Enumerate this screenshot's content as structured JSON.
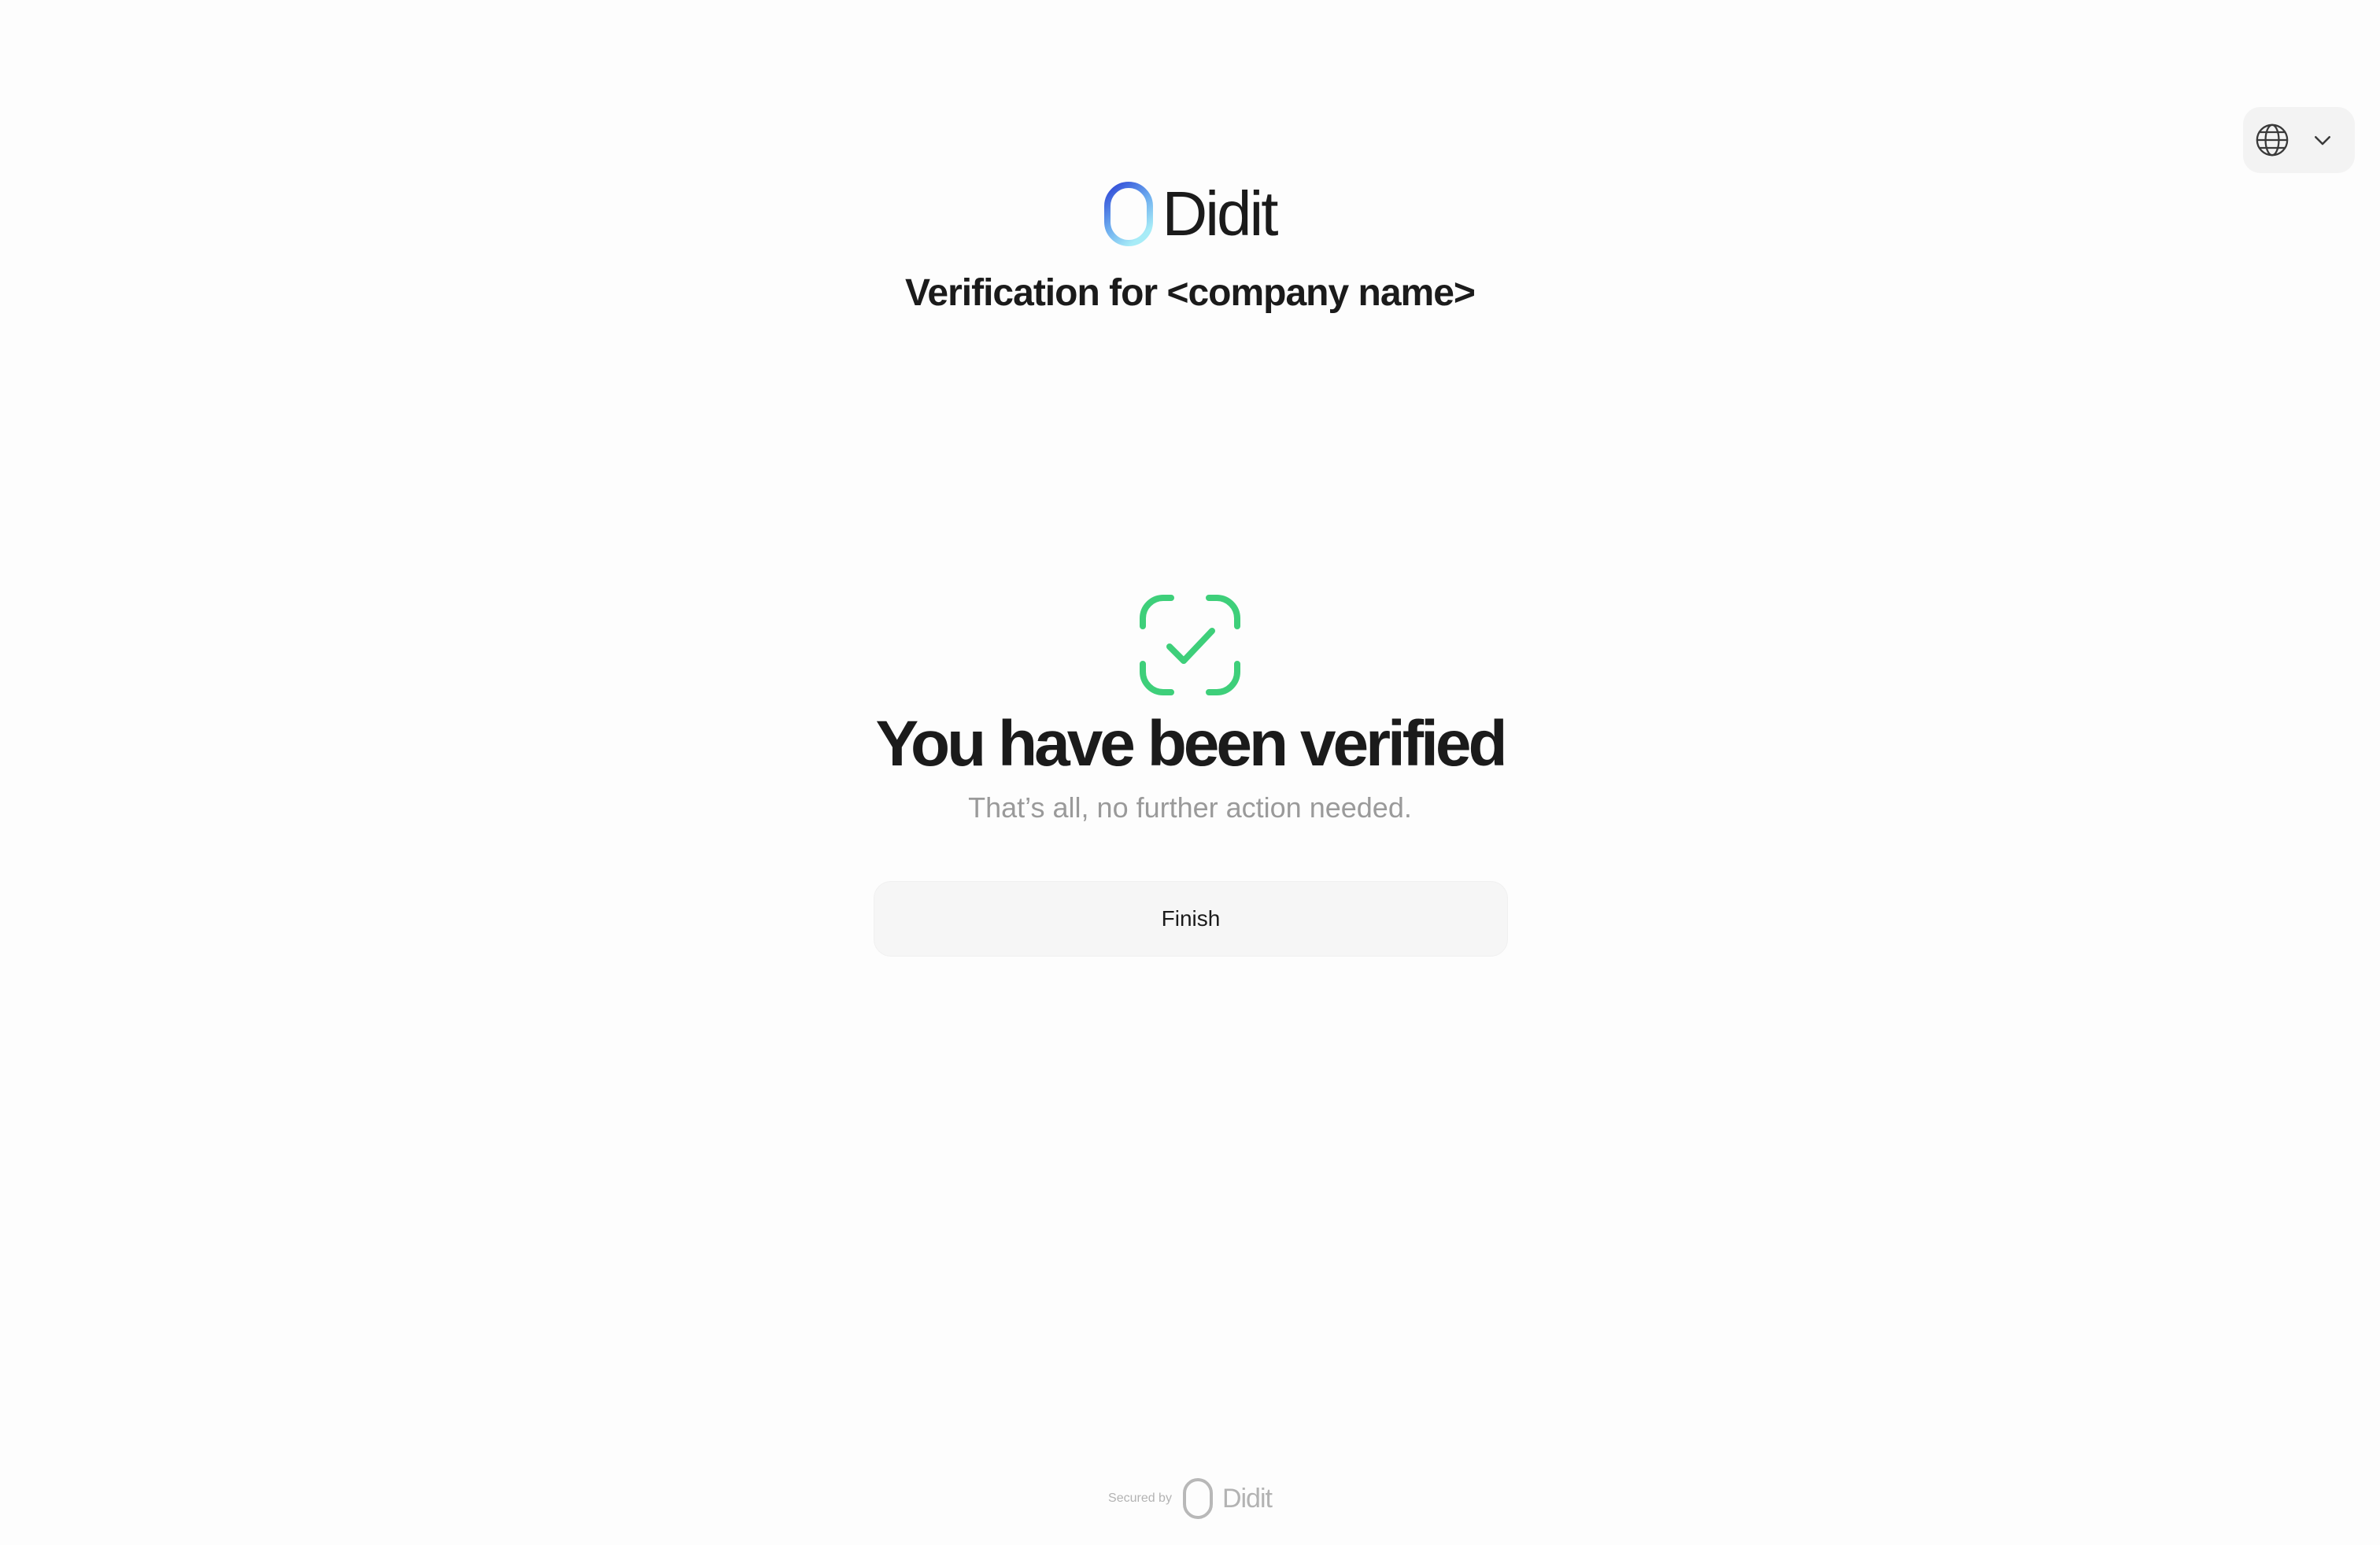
{
  "language_selector": {
    "icon": "globe-icon",
    "chevron": "chevron-down-icon"
  },
  "header": {
    "brand_name": "Didit",
    "subtitle": "Verification for <company name>"
  },
  "result": {
    "icon": "verified-check-icon",
    "headline": "You have been verified",
    "message": "That’s all, no further action needed.",
    "finish_label": "Finish"
  },
  "footer": {
    "secured_by": "Secured by",
    "brand_name": "Didit"
  },
  "colors": {
    "success": "#3ecf7a",
    "brand_gradient_start": "#2d44d6",
    "brand_gradient_end": "#8fe3f5",
    "text_primary": "#1b1b1b",
    "text_muted": "#9a9a9a"
  }
}
